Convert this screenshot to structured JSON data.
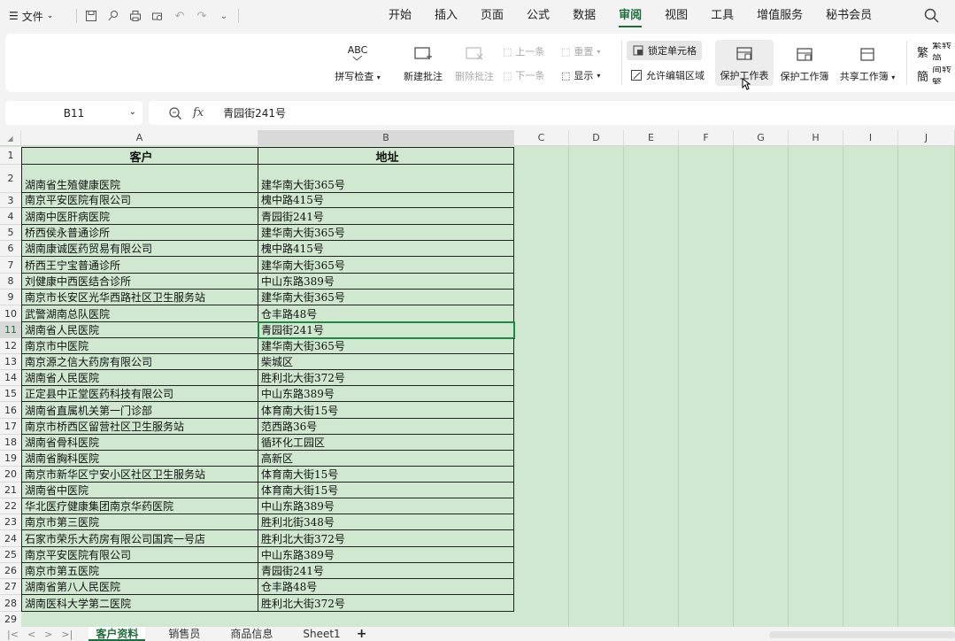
{
  "menubar": {
    "file_label": "文件",
    "tabs": [
      {
        "label": "开始"
      },
      {
        "label": "插入"
      },
      {
        "label": "页面"
      },
      {
        "label": "公式"
      },
      {
        "label": "数据"
      },
      {
        "label": "审阅",
        "active": true
      },
      {
        "label": "视图"
      },
      {
        "label": "工具"
      },
      {
        "label": "增值服务"
      },
      {
        "label": "秘书会员"
      }
    ]
  },
  "ribbon": {
    "spell_check": "拼写检查",
    "spell_icon_text": "ABC",
    "new_comment": "新建批注",
    "delete_comment": "删除批注",
    "prev": "上一条",
    "next": "下一条",
    "reset": "重置",
    "show": "显示",
    "lock_cell": "锁定单元格",
    "allow_edit_range": "允许编辑区域",
    "protect_sheet": "保护工作表",
    "protect_book": "保护工作簿",
    "share_book": "共享工作簿",
    "trad": "繁转简",
    "simp": "简转繁"
  },
  "formula_bar": {
    "cell_ref": "B11",
    "fx": "fx",
    "content": "青园街241号"
  },
  "grid": {
    "columns": [
      "A",
      "B",
      "C",
      "D",
      "E",
      "F",
      "G",
      "H",
      "I",
      "J"
    ],
    "header": {
      "a": "客户",
      "b": "地址"
    },
    "rows": [
      {
        "n": "1"
      },
      {
        "n": "2",
        "a": "湖南省生殖健康医院",
        "b": "建华南大街365号"
      },
      {
        "n": "3",
        "a": "南京平安医院有限公司",
        "b": "槐中路415号"
      },
      {
        "n": "4",
        "a": "湖南中医肝病医院",
        "b": "青园街241号"
      },
      {
        "n": "5",
        "a": "桥西侯永普通诊所",
        "b": "建华南大街365号"
      },
      {
        "n": "6",
        "a": "湖南康诚医药贸易有限公司",
        "b": "槐中路415号"
      },
      {
        "n": "7",
        "a": "桥西王宁宝普通诊所",
        "b": "建华南大街365号"
      },
      {
        "n": "8",
        "a": "刘健康中西医结合诊所",
        "b": "中山东路389号"
      },
      {
        "n": "9",
        "a": "南京市长安区光华西路社区卫生服务站",
        "b": "建华南大街365号"
      },
      {
        "n": "10",
        "a": "武警湖南总队医院",
        "b": "仓丰路48号"
      },
      {
        "n": "11",
        "a": "湖南省人民医院",
        "b": "青园街241号"
      },
      {
        "n": "12",
        "a": "南京市中医院",
        "b": "建华南大街365号"
      },
      {
        "n": "13",
        "a": "南京源之信大药房有限公司",
        "b": "柴城区"
      },
      {
        "n": "14",
        "a": "湖南省人民医院",
        "b": "胜利北大街372号"
      },
      {
        "n": "15",
        "a": "正定县中正堂医药科技有限公司",
        "b": "中山东路389号"
      },
      {
        "n": "16",
        "a": "湖南省直属机关第一门诊部",
        "b": "体育南大街15号"
      },
      {
        "n": "17",
        "a": "南京市桥西区留营社区卫生服务站",
        "b": "范西路36号"
      },
      {
        "n": "18",
        "a": "湖南省骨科医院",
        "b": "循环化工园区"
      },
      {
        "n": "19",
        "a": "湖南省胸科医院",
        "b": "高新区"
      },
      {
        "n": "20",
        "a": "南京市新华区宁安小区社区卫生服务站",
        "b": "体育南大街15号"
      },
      {
        "n": "21",
        "a": "湖南省中医院",
        "b": "体育南大街15号"
      },
      {
        "n": "22",
        "a": "华北医疗健康集团南京华药医院",
        "b": "中山东路389号"
      },
      {
        "n": "23",
        "a": "南京市第三医院",
        "b": "胜利北街348号"
      },
      {
        "n": "24",
        "a": "石家市荣乐大药房有限公司国宾一号店",
        "b": "胜利北大街372号"
      },
      {
        "n": "25",
        "a": "南京平安医院有限公司",
        "b": "中山东路389号"
      },
      {
        "n": "26",
        "a": "南京市第五医院",
        "b": "青园街241号"
      },
      {
        "n": "27",
        "a": "湖南省第八人民医院",
        "b": "仓丰路48号"
      },
      {
        "n": "28",
        "a": "湖南医科大学第二医院",
        "b": "胜利北大街372号"
      },
      {
        "n": "29"
      }
    ]
  },
  "sheets": [
    {
      "label": "客户资料",
      "active": true
    },
    {
      "label": "销售员"
    },
    {
      "label": "商品信息"
    },
    {
      "label": "Sheet1"
    }
  ],
  "add_sheet": "+",
  "colors": {
    "accent": "#1e6e3a",
    "grid_bg": "#cfe8cf",
    "selection": "#1e8a3f"
  }
}
